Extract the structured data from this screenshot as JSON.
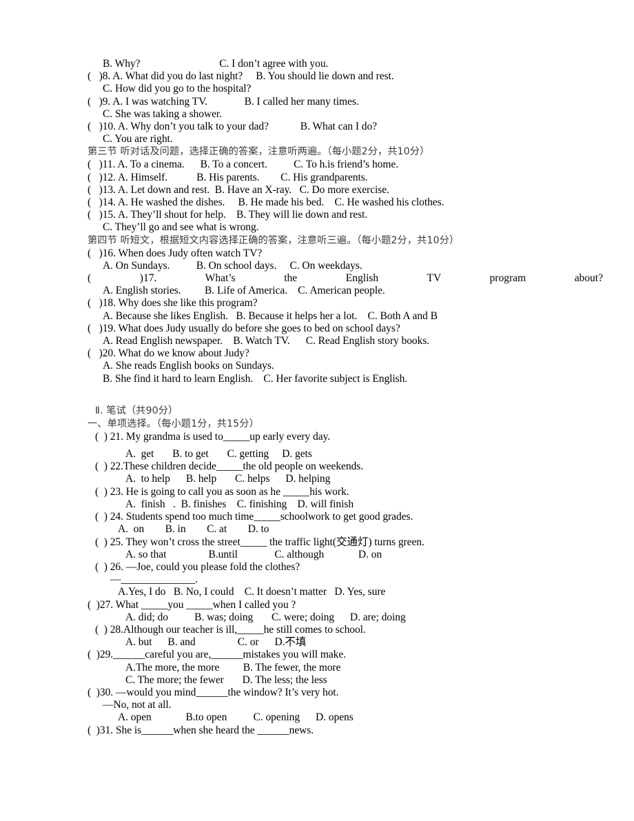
{
  "document": {
    "kind": "english-exam-paper",
    "page_background": "#ffffff",
    "text_color": "#000000",
    "heading_color": "#3a3a3a"
  },
  "listening": {
    "part_two_tail": [
      {
        "id": "l7-opts",
        "indent": 2,
        "text": "B. Why?                              C. I don’t agree with you."
      },
      {
        "id": "l8",
        "indent": 0,
        "text": "(   )8. A. What did you do last night?     B. You should lie down and rest."
      },
      {
        "id": "l8c",
        "indent": 2,
        "text": "C. How did you go to the hospital?"
      },
      {
        "id": "l9",
        "indent": 0,
        "text": "(   )9. A. I was watching TV.              B. I called her many times."
      },
      {
        "id": "l9c",
        "indent": 2,
        "text": "C. She was taking a shower."
      },
      {
        "id": "l10",
        "indent": 0,
        "text": "(   )10. A. Why don’t you talk to your dad?            B. What can I do?"
      },
      {
        "id": "l10c",
        "indent": 2,
        "text": "C. You are right."
      }
    ],
    "part_three": {
      "heading": "第三节 听对话及问题，选择正确的答案，注意听两遍。（每小题2分，共10分）",
      "items": [
        {
          "id": "l11",
          "indent": 0,
          "text": "(   )11. A. To a cinema.      B. To a concert.          C. To h.is friend’s home."
        },
        {
          "id": "l12",
          "indent": 0,
          "text": "(   )12. A. Himself.           B. His parents.        C. His grandparents."
        },
        {
          "id": "l13",
          "indent": 0,
          "text": "(   )13. A. Let down and rest.  B. Have an X-ray.   C. Do more exercise."
        },
        {
          "id": "l14",
          "indent": 0,
          "text": "(   )14. A. He washed the dishes.     B. He made his bed.    C. He washed his clothes."
        },
        {
          "id": "l15",
          "indent": 0,
          "text": "(   )15. A. They’ll shout for help.    B. They will lie down and rest."
        },
        {
          "id": "l15c",
          "indent": 2,
          "text": "C. They’ll go and see what is wrong."
        }
      ]
    },
    "part_four": {
      "heading": "第四节 听短文，根据短文内容选择正确的答案，注意听三遍。（每小题2分，共10分）",
      "items": [
        {
          "id": "l16",
          "indent": 0,
          "text": "(   )16. When does Judy often watch TV?"
        },
        {
          "id": "l16o",
          "indent": 2,
          "text": "A. On Sundays.          B. On school days.     C. On weekdays."
        },
        {
          "id": "l17",
          "indent": 0,
          "justify": true,
          "text": "(   )17. What’s the English TV program about?"
        },
        {
          "id": "l17o",
          "indent": 2,
          "text": "A. English stories.         B. Life of America.    C. American people."
        },
        {
          "id": "l18",
          "indent": 0,
          "text": "(   )18. Why does she like this program?"
        },
        {
          "id": "l18o",
          "indent": 2,
          "text": "A. Because she likes English.   B. Because it helps her a lot.    C. Both A and B"
        },
        {
          "id": "l19",
          "indent": 0,
          "text": "(   )19. What does Judy usually do before she goes to bed on school days?"
        },
        {
          "id": "l19o",
          "indent": 2,
          "text": "A. Read English newspaper.    B. Watch TV.      C. Read English story books."
        },
        {
          "id": "l20",
          "indent": 0,
          "text": "(   )20. What do we know about Judy?"
        },
        {
          "id": "l20a",
          "indent": 2,
          "text": "A. She reads English books on Sundays."
        },
        {
          "id": "l20b",
          "indent": 2,
          "text": "B. She find it hard to learn English.    C. Her favorite subject is English."
        }
      ]
    }
  },
  "written": {
    "section_heading": "Ⅱ. 笔试（共90分）",
    "part_one_heading": "一、单项选择。（每小题1分，共15分）",
    "questions": [
      {
        "id": "q21",
        "indent": 0,
        "text": "(  ) 21. My grandma is used to_____up early every day."
      },
      {
        "id": "q21o",
        "indent": 5,
        "text": "A.  get       B. to get       C. getting     D. gets",
        "spacer_before": true
      },
      {
        "id": "q22",
        "indent": 0,
        "text": "(  ) 22.These children decide_____the old people on weekends."
      },
      {
        "id": "q22o",
        "indent": 5,
        "text": "A.  to help      B. help       C. helps      D. helping"
      },
      {
        "id": "q23",
        "indent": 0,
        "text": "(  ) 23. He is going to call you as soon as he _____his work."
      },
      {
        "id": "q23o",
        "indent": 5,
        "text": "A.  finish   .  B. finishes    C. finishing    D. will finish",
        "stray": true
      },
      {
        "id": "q24",
        "indent": 0,
        "text": "(  ) 24. Students spend too much time_____schoolwork to get good grades."
      },
      {
        "id": "q24o",
        "indent": 4,
        "text": "A.  on        B. in        C. at        D. to"
      },
      {
        "id": "q25",
        "indent": 0,
        "text": "(  ) 25. They won’t cross the street_____ the traffic light(交通灯) turns green."
      },
      {
        "id": "q25o",
        "indent": 5,
        "text": "A. so that                B.until              C. although             D. on"
      },
      {
        "id": "q26",
        "indent": 0,
        "text": "(  ) 26. —Joe, could you please fold the clothes?"
      },
      {
        "id": "q26b",
        "indent": 3,
        "text": "—______________."
      },
      {
        "id": "q26o",
        "indent": 4,
        "text": "A.Yes, I do   B. No, I could    C. It doesn’t matter   D. Yes, sure"
      },
      {
        "id": "q27",
        "indent": 0,
        "text": "(  )27. What _____you _____when I called you ?"
      },
      {
        "id": "q27o",
        "indent": 5,
        "text": "A. did; do          B. was; doing       C. were; doing      D. are; doing"
      },
      {
        "id": "q28",
        "indent": 0,
        "text": "(  ) 28.Although our teacher is ill,_____he still comes to school."
      },
      {
        "id": "q28o",
        "indent": 5,
        "text": "A. but      B. and                C. or      D.不填"
      },
      {
        "id": "q29",
        "indent": 0,
        "text": "(  )29.______careful you are,______mistakes you will make."
      },
      {
        "id": "q29a",
        "indent": 5,
        "text": "A.The more, the more         B. The fewer, the more"
      },
      {
        "id": "q29b",
        "indent": 5,
        "text": "C. The more; the fewer       D. The less; the less"
      },
      {
        "id": "q30",
        "indent": 0,
        "text": "(  )30. —would you mind______the window? It’s very hot."
      },
      {
        "id": "q30b",
        "indent": 2,
        "text": "—No, not at all."
      },
      {
        "id": "q30o",
        "indent": 4,
        "text": "A. open             B.to open          C. opening      D. opens"
      },
      {
        "id": "q31",
        "indent": 0,
        "text": "(  )31. She is______when she heard the ______news."
      }
    ]
  }
}
